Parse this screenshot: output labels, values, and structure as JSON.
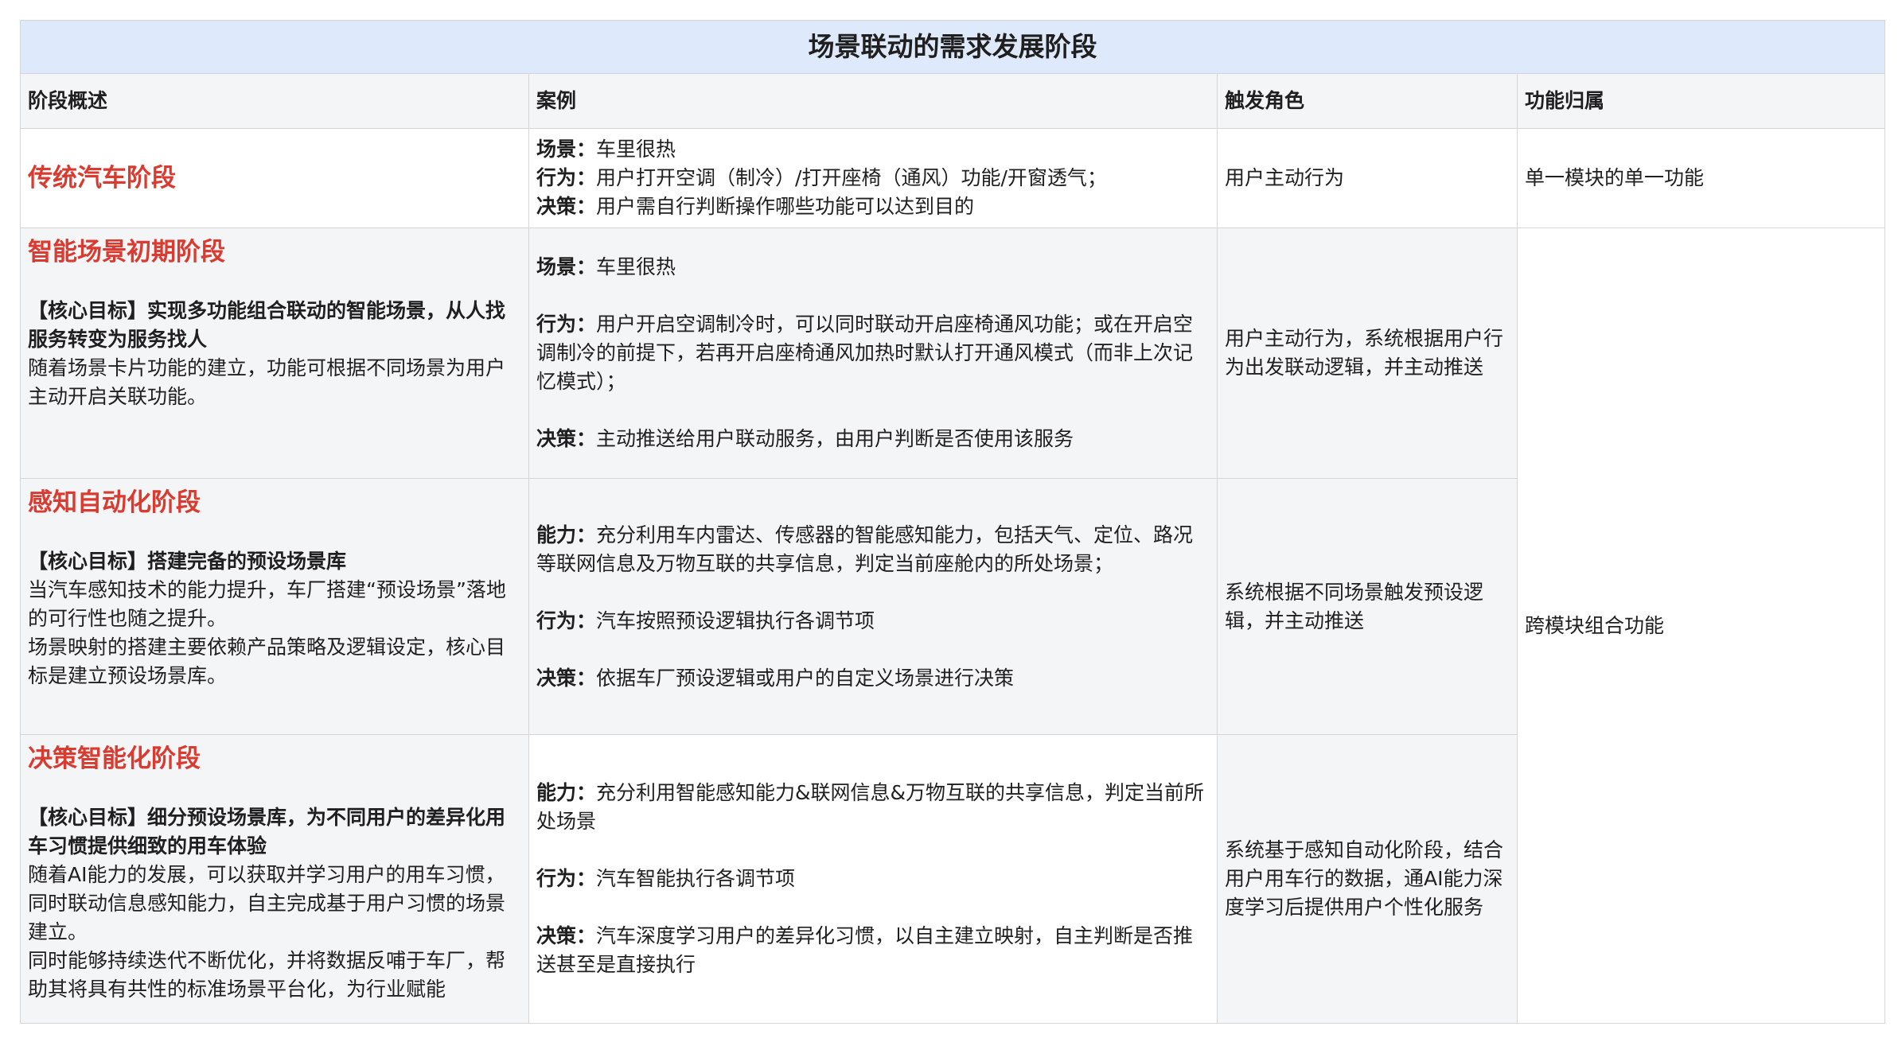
{
  "title": "场景联动的需求发展阶段",
  "headers": [
    "阶段概述",
    "案例",
    "触发角色",
    "功能归属"
  ],
  "rows": [
    {
      "stage": "传统汽车阶段",
      "case": {
        "l1k": "场景：",
        "l1v": "车里很热",
        "l2k": "行为：",
        "l2v": "用户打开空调（制冷）/打开座椅（通风）功能/开窗透气；",
        "l3k": "决策：",
        "l3v": "用户需自行判断操作哪些功能可以达到目的"
      },
      "role": "用户主动行为",
      "belong": "单一模块的单一功能"
    },
    {
      "stage": "智能场景初期阶段",
      "goal": "【核心目标】实现多功能组合联动的智能场景，从人找服务转变为服务找人",
      "desc": [
        "随着场景卡片功能的建立，功能可根据不同场景为用户主动开启关联功能。"
      ],
      "case": {
        "l1k": "场景：",
        "l1v": "车里很热",
        "l2k": "行为：",
        "l2v": "用户开启空调制冷时，可以同时联动开启座椅通风功能；或在开启空调制冷的前提下，若再开启座椅通风加热时默认打开通风模式（而非上次记忆模式）；",
        "l3k": "决策：",
        "l3v": "主动推送给用户联动服务，由用户判断是否使用该服务"
      },
      "role": "用户主动行为，系统根据用户行为出发联动逻辑，并主动推送",
      "belong": "跨模块组合功能"
    },
    {
      "stage": "感知自动化阶段",
      "goal": "【核心目标】搭建完备的预设场景库",
      "desc": [
        "当汽车感知技术的能力提升，车厂搭建“预设场景”落地的可行性也随之提升。",
        "场景映射的搭建主要依赖产品策略及逻辑设定，核心目标是建立预设场景库。"
      ],
      "case": {
        "l1k": "能力：",
        "l1v": "充分利用车内雷达、传感器的智能感知能力，包括天气、定位、路况等联网信息及万物互联的共享信息，判定当前座舱内的所处场景；",
        "l2k": "行为：",
        "l2v": "汽车按照预设逻辑执行各调节项",
        "l3k": "决策：",
        "l3v": "依据车厂预设逻辑或用户的自定义场景进行决策"
      },
      "role": "系统根据不同场景触发预设逻辑，并主动推送"
    },
    {
      "stage": "决策智能化阶段",
      "goal": "【核心目标】细分预设场景库，为不同用户的差异化用车习惯提供细致的用车体验",
      "desc": [
        "随着AI能力的发展，可以获取并学习用户的用车习惯，同时联动信息感知能力，自主完成基于用户习惯的场景建立。",
        "同时能够持续迭代不断优化，并将数据反哺于车厂，帮助其将具有共性的标准场景平台化，为行业赋能"
      ],
      "case": {
        "l1k": "能力：",
        "l1v": "充分利用智能感知能力&联网信息&万物互联的共享信息，判定当前所处场景",
        "l2k": "行为：",
        "l2v": "汽车智能执行各调节项",
        "l3k": "决策：",
        "l3v": "汽车深度学习用户的差异化习惯，以自主建立映射，自主判断是否推送甚至是直接执行"
      },
      "role": "系统基于感知自动化阶段，结合用户用车行的数据，通AI能力深度学习后提供用户个性化服务"
    }
  ]
}
